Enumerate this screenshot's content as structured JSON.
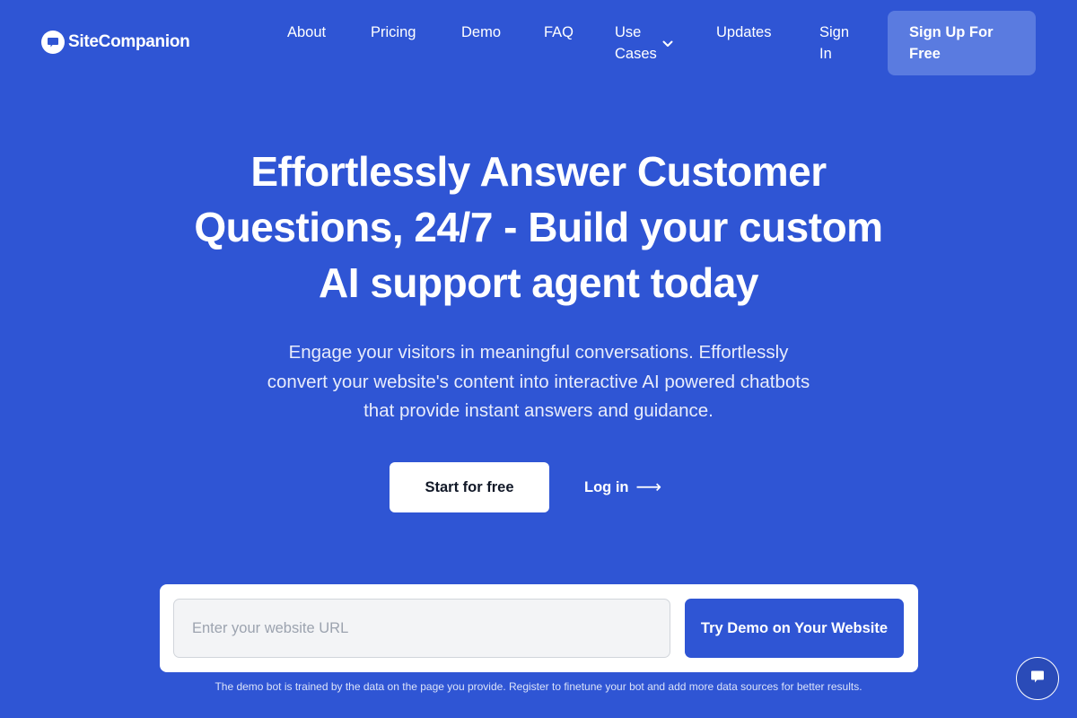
{
  "brand": {
    "name": "SiteCompanion",
    "logo_icon": "chat-bubble-icon"
  },
  "nav": {
    "items": [
      {
        "label": "About"
      },
      {
        "label": "Pricing"
      },
      {
        "label": "Demo"
      },
      {
        "label": "FAQ"
      },
      {
        "label": "Use Cases",
        "icon": "chevron-down-icon"
      },
      {
        "label": "Updates"
      },
      {
        "label": "Sign In"
      }
    ],
    "signup_label": "Sign Up For Free"
  },
  "hero": {
    "title": "Effortlessly Answer Customer Questions, 24/7 - Build your custom AI support agent today",
    "subtitle": "Engage your visitors in meaningful conversations. Effortlessly convert your website's content into interactive AI powered chatbots that provide instant answers and guidance.",
    "start_label": "Start for free",
    "login_label": "Log in",
    "login_arrow": "⟶"
  },
  "demo": {
    "url_value": "",
    "url_placeholder": "Enter your website URL",
    "try_label": "Try Demo on Your Website",
    "disclaimer": "The demo bot is trained by the data on the page you provide. Register to finetune your bot and add more data sources for better results."
  },
  "chat_widget": {
    "icon": "chat-bubble-icon"
  },
  "colors": {
    "background": "#2f55d4",
    "signup_button": "#5a7be0",
    "primary_button": "#2f55d4",
    "white": "#ffffff"
  }
}
